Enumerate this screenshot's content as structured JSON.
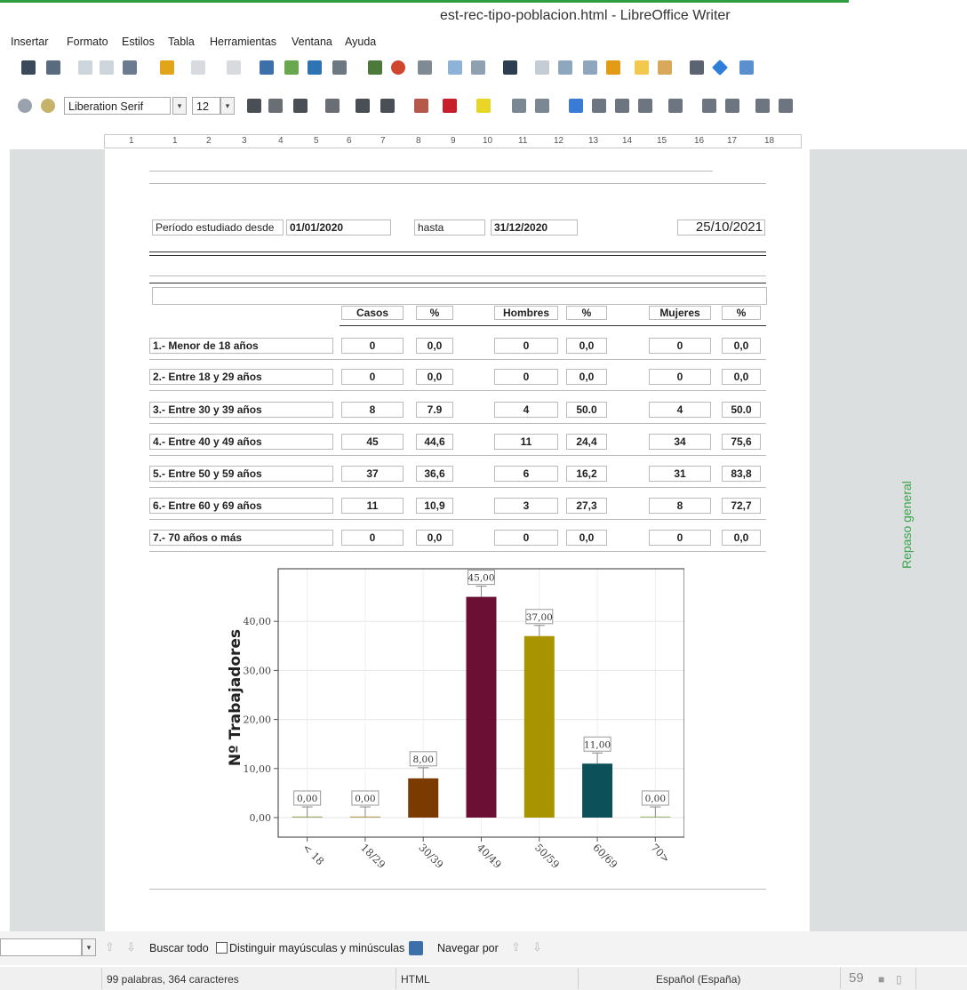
{
  "window": {
    "title": "est-rec-tipo-poblacion.html - LibreOffice Writer"
  },
  "menu": [
    "Insertar",
    "Formato",
    "Estilos",
    "Tabla",
    "Herramientas",
    "Ventana",
    "Ayuda"
  ],
  "format_toolbar": {
    "font_name": "Liberation Serif",
    "font_size": "12"
  },
  "ruler": [
    "1",
    "1",
    "2",
    "3",
    "4",
    "5",
    "6",
    "7",
    "8",
    "9",
    "10",
    "11",
    "12",
    "13",
    "14",
    "15",
    "16",
    "17",
    "18"
  ],
  "document": {
    "period_label": "Período estudiado desde",
    "period_from": "01/01/2020",
    "period_to_label": "hasta",
    "period_to": "31/12/2020",
    "report_date": "25/10/2021",
    "table": {
      "headers": [
        "Casos",
        "%",
        "Hombres",
        "%",
        "Mujeres",
        "%"
      ],
      "rows": [
        {
          "label": "1.- Menor de 18 años",
          "casos": "0",
          "pct": "0,0",
          "hombres": "0",
          "pct_h": "0,0",
          "mujeres": "0",
          "pct_m": "0,0"
        },
        {
          "label": "2.- Entre 18 y 29 años",
          "casos": "0",
          "pct": "0,0",
          "hombres": "0",
          "pct_h": "0,0",
          "mujeres": "0",
          "pct_m": "0,0"
        },
        {
          "label": "3.- Entre 30 y 39 años",
          "casos": "8",
          "pct": "7.9",
          "hombres": "4",
          "pct_h": "50.0",
          "mujeres": "4",
          "pct_m": "50.0"
        },
        {
          "label": "4.- Entre 40 y 49 años",
          "casos": "45",
          "pct": "44,6",
          "hombres": "11",
          "pct_h": "24,4",
          "mujeres": "34",
          "pct_m": "75,6"
        },
        {
          "label": "5.- Entre 50 y 59 años",
          "casos": "37",
          "pct": "36,6",
          "hombres": "6",
          "pct_h": "16,2",
          "mujeres": "31",
          "pct_m": "83,8"
        },
        {
          "label": "6.- Entre 60 y 69 años",
          "casos": "11",
          "pct": "10,9",
          "hombres": "3",
          "pct_h": "27,3",
          "mujeres": "8",
          "pct_m": "72,7"
        },
        {
          "label": "7.- 70 años o más",
          "casos": "0",
          "pct": "0,0",
          "hombres": "0",
          "pct_h": "0,0",
          "mujeres": "0",
          "pct_m": "0,0"
        }
      ]
    }
  },
  "sidebar_label": "Repaso general",
  "chart_data": {
    "type": "bar",
    "categories": [
      "< 18",
      "18/29",
      "30/39",
      "40/49",
      "50/59",
      "60/69",
      "70>"
    ],
    "values": [
      0,
      0,
      8,
      45,
      37,
      11,
      0
    ],
    "data_labels": [
      "0,00",
      "0,00",
      "8,00",
      "45,00",
      "37,00",
      "11,00",
      "0,00"
    ],
    "colors": [
      "#9aa86a",
      "#b0a060",
      "#7a3a00",
      "#6b0f35",
      "#a89400",
      "#0c5059",
      "#a0b878"
    ],
    "ylabel": "Nº Trabajadores",
    "yticks": [
      "0,00",
      "10,00",
      "20,00",
      "30,00",
      "40,00"
    ],
    "ylim": [
      0,
      48
    ],
    "grid": true
  },
  "findbar": {
    "find_all": "Buscar todo",
    "match_case": "Distinguir mayúsculas y minúsculas",
    "navigate": "Navegar por"
  },
  "statusbar": {
    "words": "99 palabras, 364 caracteres",
    "format": "HTML",
    "language": "Español (España)",
    "zoom": "59"
  }
}
